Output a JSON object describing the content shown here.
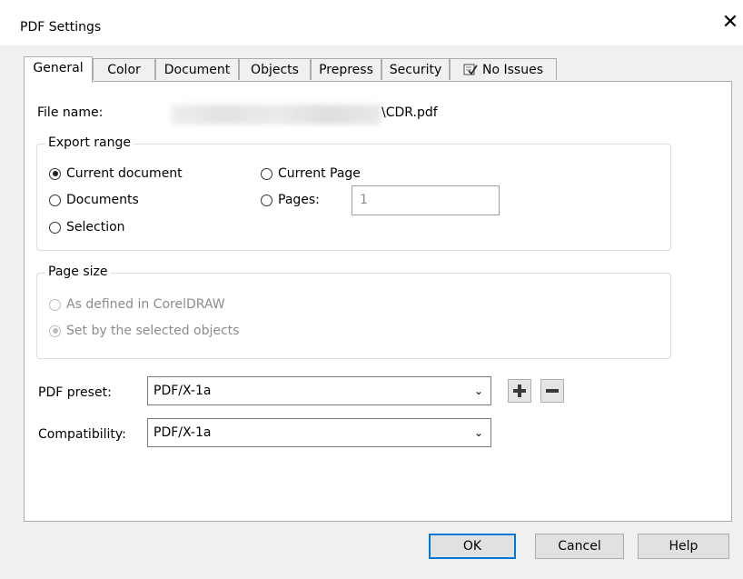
{
  "window": {
    "title": "PDF Settings",
    "close_glyph": "✕"
  },
  "tabs": [
    {
      "label": "General",
      "active": true
    },
    {
      "label": "Color"
    },
    {
      "label": "Document"
    },
    {
      "label": "Objects"
    },
    {
      "label": "Prepress"
    },
    {
      "label": "Security"
    },
    {
      "label": "No Issues",
      "icon": "checklist-icon"
    }
  ],
  "general": {
    "file_name_label": "File name:",
    "file_name_value": "\\CDR.pdf",
    "export_range": {
      "legend": "Export range",
      "options": [
        {
          "label": "Current document",
          "checked": true
        },
        {
          "label": "Documents",
          "checked": false
        },
        {
          "label": "Selection",
          "checked": false
        },
        {
          "label": "Current Page",
          "checked": false
        },
        {
          "label": "Pages:",
          "checked": false
        }
      ],
      "pages_value": "1"
    },
    "page_size": {
      "legend": "Page size",
      "options": [
        {
          "label": "As defined in CorelDRAW",
          "checked": false,
          "disabled": true
        },
        {
          "label": "Set by the selected objects",
          "checked": true,
          "disabled": true
        }
      ]
    },
    "pdf_preset": {
      "label": "PDF preset:",
      "value": "PDF/X-1a"
    },
    "compatibility": {
      "label": "Compatibility:",
      "value": "PDF/X-1a"
    }
  },
  "buttons": {
    "ok": "OK",
    "cancel": "Cancel",
    "help": "Help"
  }
}
